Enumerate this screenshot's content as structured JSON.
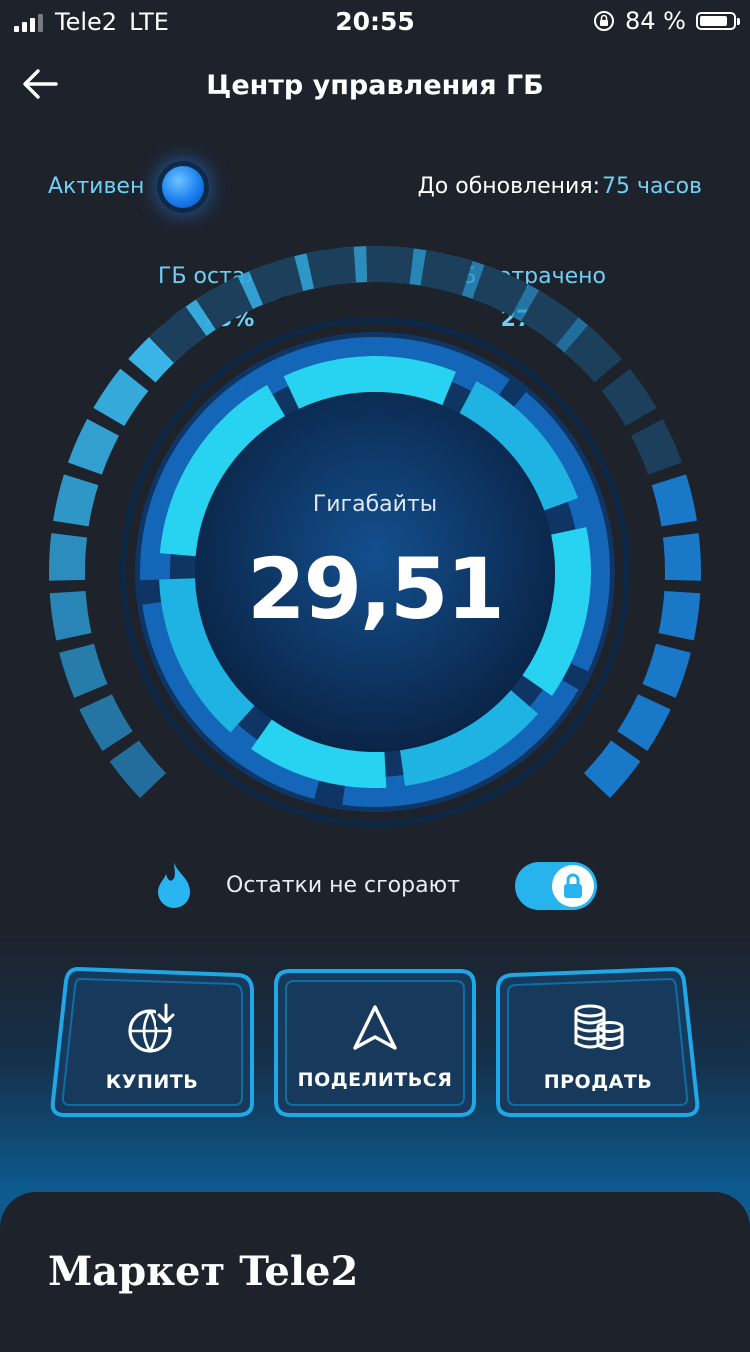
{
  "status_bar": {
    "carrier": "Tele2",
    "network": "LTE",
    "time": "20:55",
    "battery": "84 %",
    "battery_level": 0.84
  },
  "header": {
    "title": "Центр управления ГБ",
    "back_icon": "arrow-left-icon"
  },
  "status": {
    "active_label": "Активен",
    "update_label": "До обновления:",
    "update_value": "75 часов"
  },
  "gauge": {
    "left_label": "ГБ осталось",
    "left_percent": "73%",
    "right_label": "ГБ потрачено",
    "right_percent": "27%",
    "caption": "Гигабайты",
    "value": "29,51",
    "remaining_fraction": 0.73,
    "spent_fraction": 0.27
  },
  "rollover": {
    "icon": "flame-icon",
    "label": "Остатки не сгорают",
    "enabled": true,
    "toggle_icon": "lock-icon"
  },
  "actions": [
    {
      "label": "КУПИТЬ",
      "icon": "globe-download-icon"
    },
    {
      "label": "ПОДЕЛИТЬСЯ",
      "icon": "navigation-arrow-icon"
    },
    {
      "label": "ПРОДАТЬ",
      "icon": "coins-stack-icon"
    }
  ],
  "market": {
    "title": "Маркет Tele2"
  },
  "colors": {
    "background": "#1e222b",
    "accent": "#6fd0f5",
    "gauge_bright": "#27d3f0",
    "gauge_dark": "#1160b0",
    "button_border": "#1fa7e6"
  }
}
